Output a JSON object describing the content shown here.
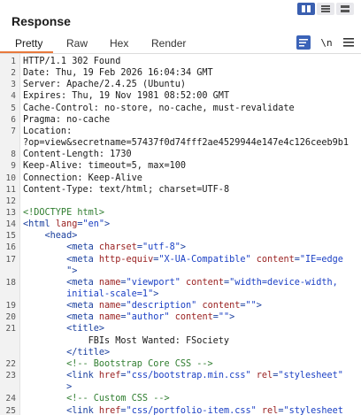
{
  "panel": {
    "title": "Response"
  },
  "view_buttons": [
    "split-view",
    "horizontal-view",
    "vertical-view"
  ],
  "tabs": [
    {
      "label": "Pretty",
      "active": true
    },
    {
      "label": "Raw",
      "active": false
    },
    {
      "label": "Hex",
      "active": false
    },
    {
      "label": "Render",
      "active": false
    }
  ],
  "tools": {
    "newline_label": "\\n"
  },
  "colors": {
    "accent_tab": "#e8793c",
    "active_button": "#3a5fb0",
    "tag": "#1a3f9e",
    "attr": "#9a2222",
    "value": "#1a3fc4",
    "comment": "#2f7d2f"
  },
  "lines": [
    {
      "n": "1",
      "segments": [
        [
          "HTTP/1.1 302 Found",
          "hk"
        ]
      ]
    },
    {
      "n": "2",
      "segments": [
        [
          "Date",
          "hk"
        ],
        [
          ": Thu, 19 Feb 2026 16:04:34 GMT",
          "hk"
        ]
      ]
    },
    {
      "n": "3",
      "segments": [
        [
          "Server",
          "hk"
        ],
        [
          ": Apache/2.4.25 (Ubuntu)",
          "hk"
        ]
      ]
    },
    {
      "n": "4",
      "segments": [
        [
          "Expires",
          "hk"
        ],
        [
          ": Thu, 19 Nov 1981 08:52:00 GMT",
          "hk"
        ]
      ]
    },
    {
      "n": "5",
      "segments": [
        [
          "Cache-Control",
          "hk"
        ],
        [
          ": no-store, no-cache, must-revalidate",
          "hk"
        ]
      ]
    },
    {
      "n": "6",
      "segments": [
        [
          "Pragma",
          "hk"
        ],
        [
          ": no-cache",
          "hk"
        ]
      ]
    },
    {
      "n": "7",
      "segments": [
        [
          "Location",
          "hk"
        ],
        [
          ":",
          "hk"
        ]
      ]
    },
    {
      "n": "",
      "segments": [
        [
          "?op=view&secretname=57437f0d74fff2ae4529944e147e4c126ceeb9b1",
          "hk"
        ]
      ]
    },
    {
      "n": "8",
      "segments": [
        [
          "Content-Length",
          "hk"
        ],
        [
          ": 1730",
          "hk"
        ]
      ]
    },
    {
      "n": "9",
      "segments": [
        [
          "Keep-Alive",
          "hk"
        ],
        [
          ": timeout=5, max=100",
          "hk"
        ]
      ]
    },
    {
      "n": "10",
      "segments": [
        [
          "Connection",
          "hk"
        ],
        [
          ": Keep-Alive",
          "hk"
        ]
      ]
    },
    {
      "n": "11",
      "segments": [
        [
          "Content-Type",
          "hk"
        ],
        [
          ": text/html; charset=UTF-8",
          "hk"
        ]
      ]
    },
    {
      "n": "12",
      "segments": []
    },
    {
      "n": "13",
      "segments": [
        [
          "<!DOCTYPE html>",
          "doctype"
        ]
      ]
    },
    {
      "n": "14",
      "segments": [
        [
          "<html ",
          "tag"
        ],
        [
          "lang",
          "attr"
        ],
        [
          "=",
          "tag"
        ],
        [
          "\"en\"",
          "val"
        ],
        [
          ">",
          "tag"
        ]
      ]
    },
    {
      "n": "15",
      "segments": [
        [
          "    <head>",
          "tag"
        ]
      ]
    },
    {
      "n": "16",
      "segments": [
        [
          "        <meta ",
          "tag"
        ],
        [
          "charset",
          "attr"
        ],
        [
          "=",
          "tag"
        ],
        [
          "\"utf-8\"",
          "val"
        ],
        [
          ">",
          "tag"
        ]
      ]
    },
    {
      "n": "17",
      "segments": [
        [
          "        <meta ",
          "tag"
        ],
        [
          "http-equiv",
          "attr"
        ],
        [
          "=",
          "tag"
        ],
        [
          "\"X-UA-Compatible\"",
          "val"
        ],
        [
          " ",
          "tag"
        ],
        [
          "content",
          "attr"
        ],
        [
          "=",
          "tag"
        ],
        [
          "\"IE=edge",
          "val"
        ]
      ]
    },
    {
      "n": "",
      "segments": [
        [
          "        \">",
          "tag"
        ]
      ]
    },
    {
      "n": "18",
      "segments": [
        [
          "        <meta ",
          "tag"
        ],
        [
          "name",
          "attr"
        ],
        [
          "=",
          "tag"
        ],
        [
          "\"viewport\"",
          "val"
        ],
        [
          " ",
          "tag"
        ],
        [
          "content",
          "attr"
        ],
        [
          "=",
          "tag"
        ],
        [
          "\"width=device-width,",
          "val"
        ]
      ]
    },
    {
      "n": "",
      "segments": [
        [
          "        initial-scale=1\"",
          "val"
        ],
        [
          ">",
          "tag"
        ]
      ]
    },
    {
      "n": "19",
      "segments": [
        [
          "        <meta ",
          "tag"
        ],
        [
          "name",
          "attr"
        ],
        [
          "=",
          "tag"
        ],
        [
          "\"description\"",
          "val"
        ],
        [
          " ",
          "tag"
        ],
        [
          "content",
          "attr"
        ],
        [
          "=",
          "tag"
        ],
        [
          "\"\"",
          "val"
        ],
        [
          ">",
          "tag"
        ]
      ]
    },
    {
      "n": "20",
      "segments": [
        [
          "        <meta ",
          "tag"
        ],
        [
          "name",
          "attr"
        ],
        [
          "=",
          "tag"
        ],
        [
          "\"author\"",
          "val"
        ],
        [
          " ",
          "tag"
        ],
        [
          "content",
          "attr"
        ],
        [
          "=",
          "tag"
        ],
        [
          "\"\"",
          "val"
        ],
        [
          ">",
          "tag"
        ]
      ]
    },
    {
      "n": "21",
      "segments": [
        [
          "        <title>",
          "tag"
        ]
      ]
    },
    {
      "n": "",
      "segments": [
        [
          "            FBIs Most Wanted: FSociety",
          "hk"
        ]
      ]
    },
    {
      "n": "",
      "segments": [
        [
          "        </title>",
          "tag"
        ]
      ]
    },
    {
      "n": "22",
      "segments": [
        [
          "        <!-- Bootstrap Core CSS -->",
          "cmt"
        ]
      ]
    },
    {
      "n": "23",
      "segments": [
        [
          "        <link ",
          "tag"
        ],
        [
          "href",
          "attr"
        ],
        [
          "=",
          "tag"
        ],
        [
          "\"css/bootstrap.min.css\"",
          "val"
        ],
        [
          " ",
          "tag"
        ],
        [
          "rel",
          "attr"
        ],
        [
          "=",
          "tag"
        ],
        [
          "\"stylesheet\"",
          "val"
        ]
      ]
    },
    {
      "n": "",
      "segments": [
        [
          "        >",
          "tag"
        ]
      ]
    },
    {
      "n": "24",
      "segments": [
        [
          "        <!-- Custom CSS -->",
          "cmt"
        ]
      ]
    },
    {
      "n": "25",
      "segments": [
        [
          "        <link ",
          "tag"
        ],
        [
          "href",
          "attr"
        ],
        [
          "=",
          "tag"
        ],
        [
          "\"css/portfolio-item.css\"",
          "val"
        ],
        [
          " ",
          "tag"
        ],
        [
          "rel",
          "attr"
        ],
        [
          "=",
          "tag"
        ],
        [
          "\"stylesheet",
          "val"
        ]
      ]
    }
  ]
}
